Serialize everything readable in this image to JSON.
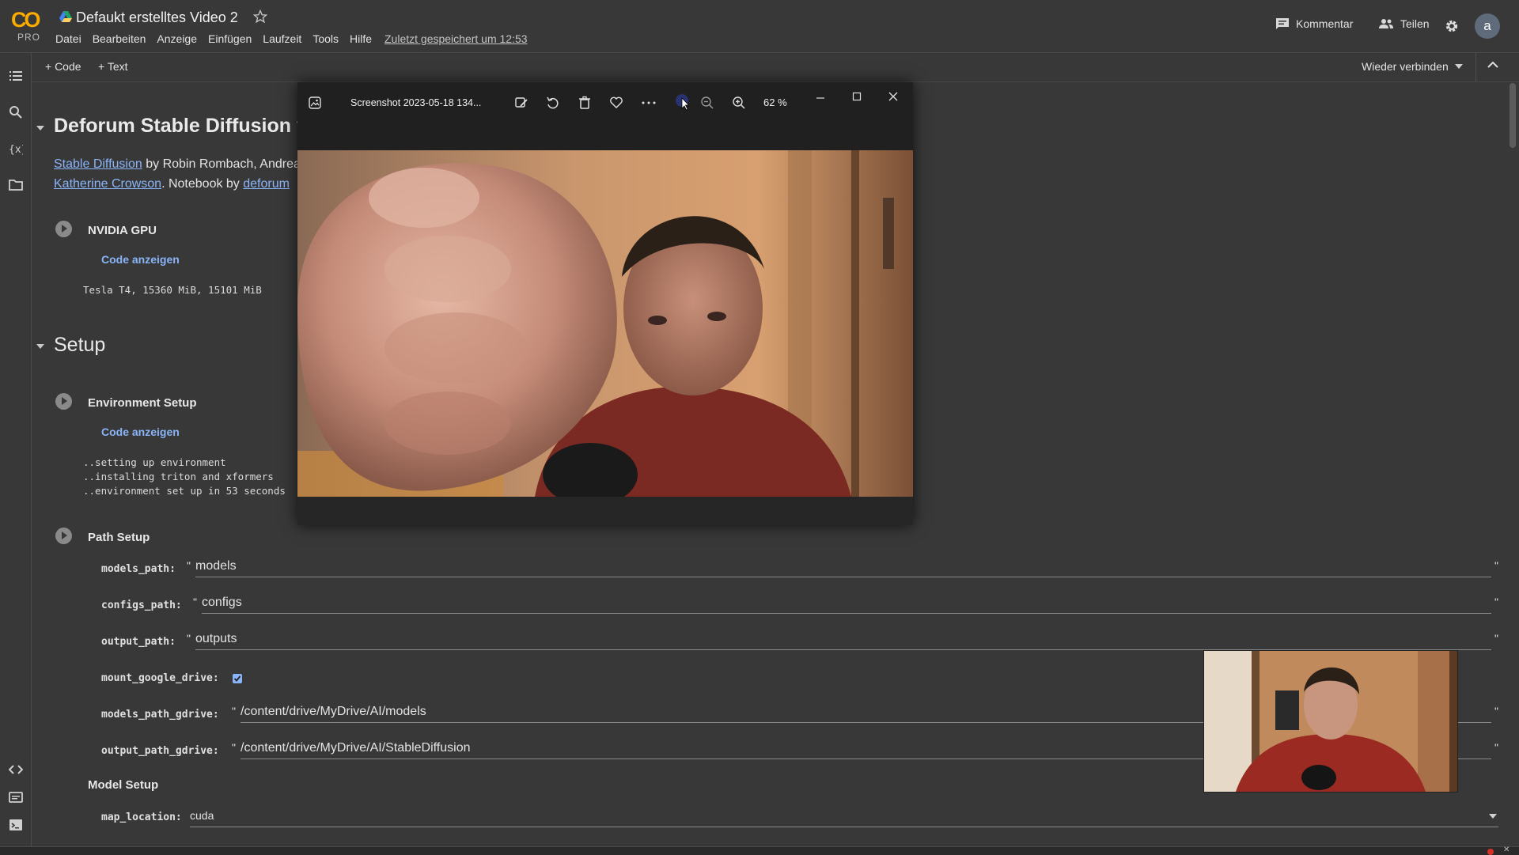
{
  "header": {
    "logo_text": "CO",
    "logo_badge": "PRO",
    "title": "Defaukt erstelltes Video 2",
    "menu": [
      "Datei",
      "Bearbeiten",
      "Anzeige",
      "Einfügen",
      "Laufzeit",
      "Tools",
      "Hilfe"
    ],
    "saved_note": "Zuletzt gespeichert um 12:53",
    "comment_label": "Kommentar",
    "share_label": "Teilen",
    "avatar_letter": "a"
  },
  "toolbar": {
    "add_code": "+ Code",
    "add_text": "+ Text",
    "reconnect": "Wieder verbinden"
  },
  "notebook": {
    "section1_title": "Deforum Stable Diffusion v",
    "intro_link1": "Stable Diffusion",
    "intro_text1": " by Robin Rombach, Andrea",
    "intro_link2": "Katherine Crowson",
    "intro_text2": ". Notebook by ",
    "intro_link3": "deforum",
    "gpu_cell": {
      "title": "NVIDIA GPU",
      "show_code": "Code anzeigen",
      "output": "Tesla T4, 15360 MiB, 15101 MiB"
    },
    "section2_title": "Setup",
    "env_cell": {
      "title": "Environment Setup",
      "show_code": "Code anzeigen",
      "output": "..setting up environment\n..installing triton and xformers\n..environment set up in 53 seconds"
    },
    "path_cell": {
      "title": "Path Setup",
      "fields": [
        {
          "label": "models_path:",
          "value": "models"
        },
        {
          "label": "configs_path:",
          "value": "configs"
        },
        {
          "label": "output_path:",
          "value": "outputs"
        },
        {
          "label": "mount_google_drive:",
          "checked": true
        },
        {
          "label": "models_path_gdrive:",
          "value": "/content/drive/MyDrive/AI/models"
        },
        {
          "label": "output_path_gdrive:",
          "value": "/content/drive/MyDrive/AI/StableDiffusion"
        }
      ]
    },
    "model_setup": {
      "title": "Model Setup",
      "map_location_label": "map_location:",
      "map_location_value": "cuda"
    }
  },
  "viewer": {
    "filename": "Screenshot 2023-05-18 134...",
    "zoom": "62 %"
  },
  "colors": {
    "background": "#383838",
    "link": "#8ab4f8",
    "logo": "#f9ab00",
    "viewer_bg": "#202020"
  }
}
